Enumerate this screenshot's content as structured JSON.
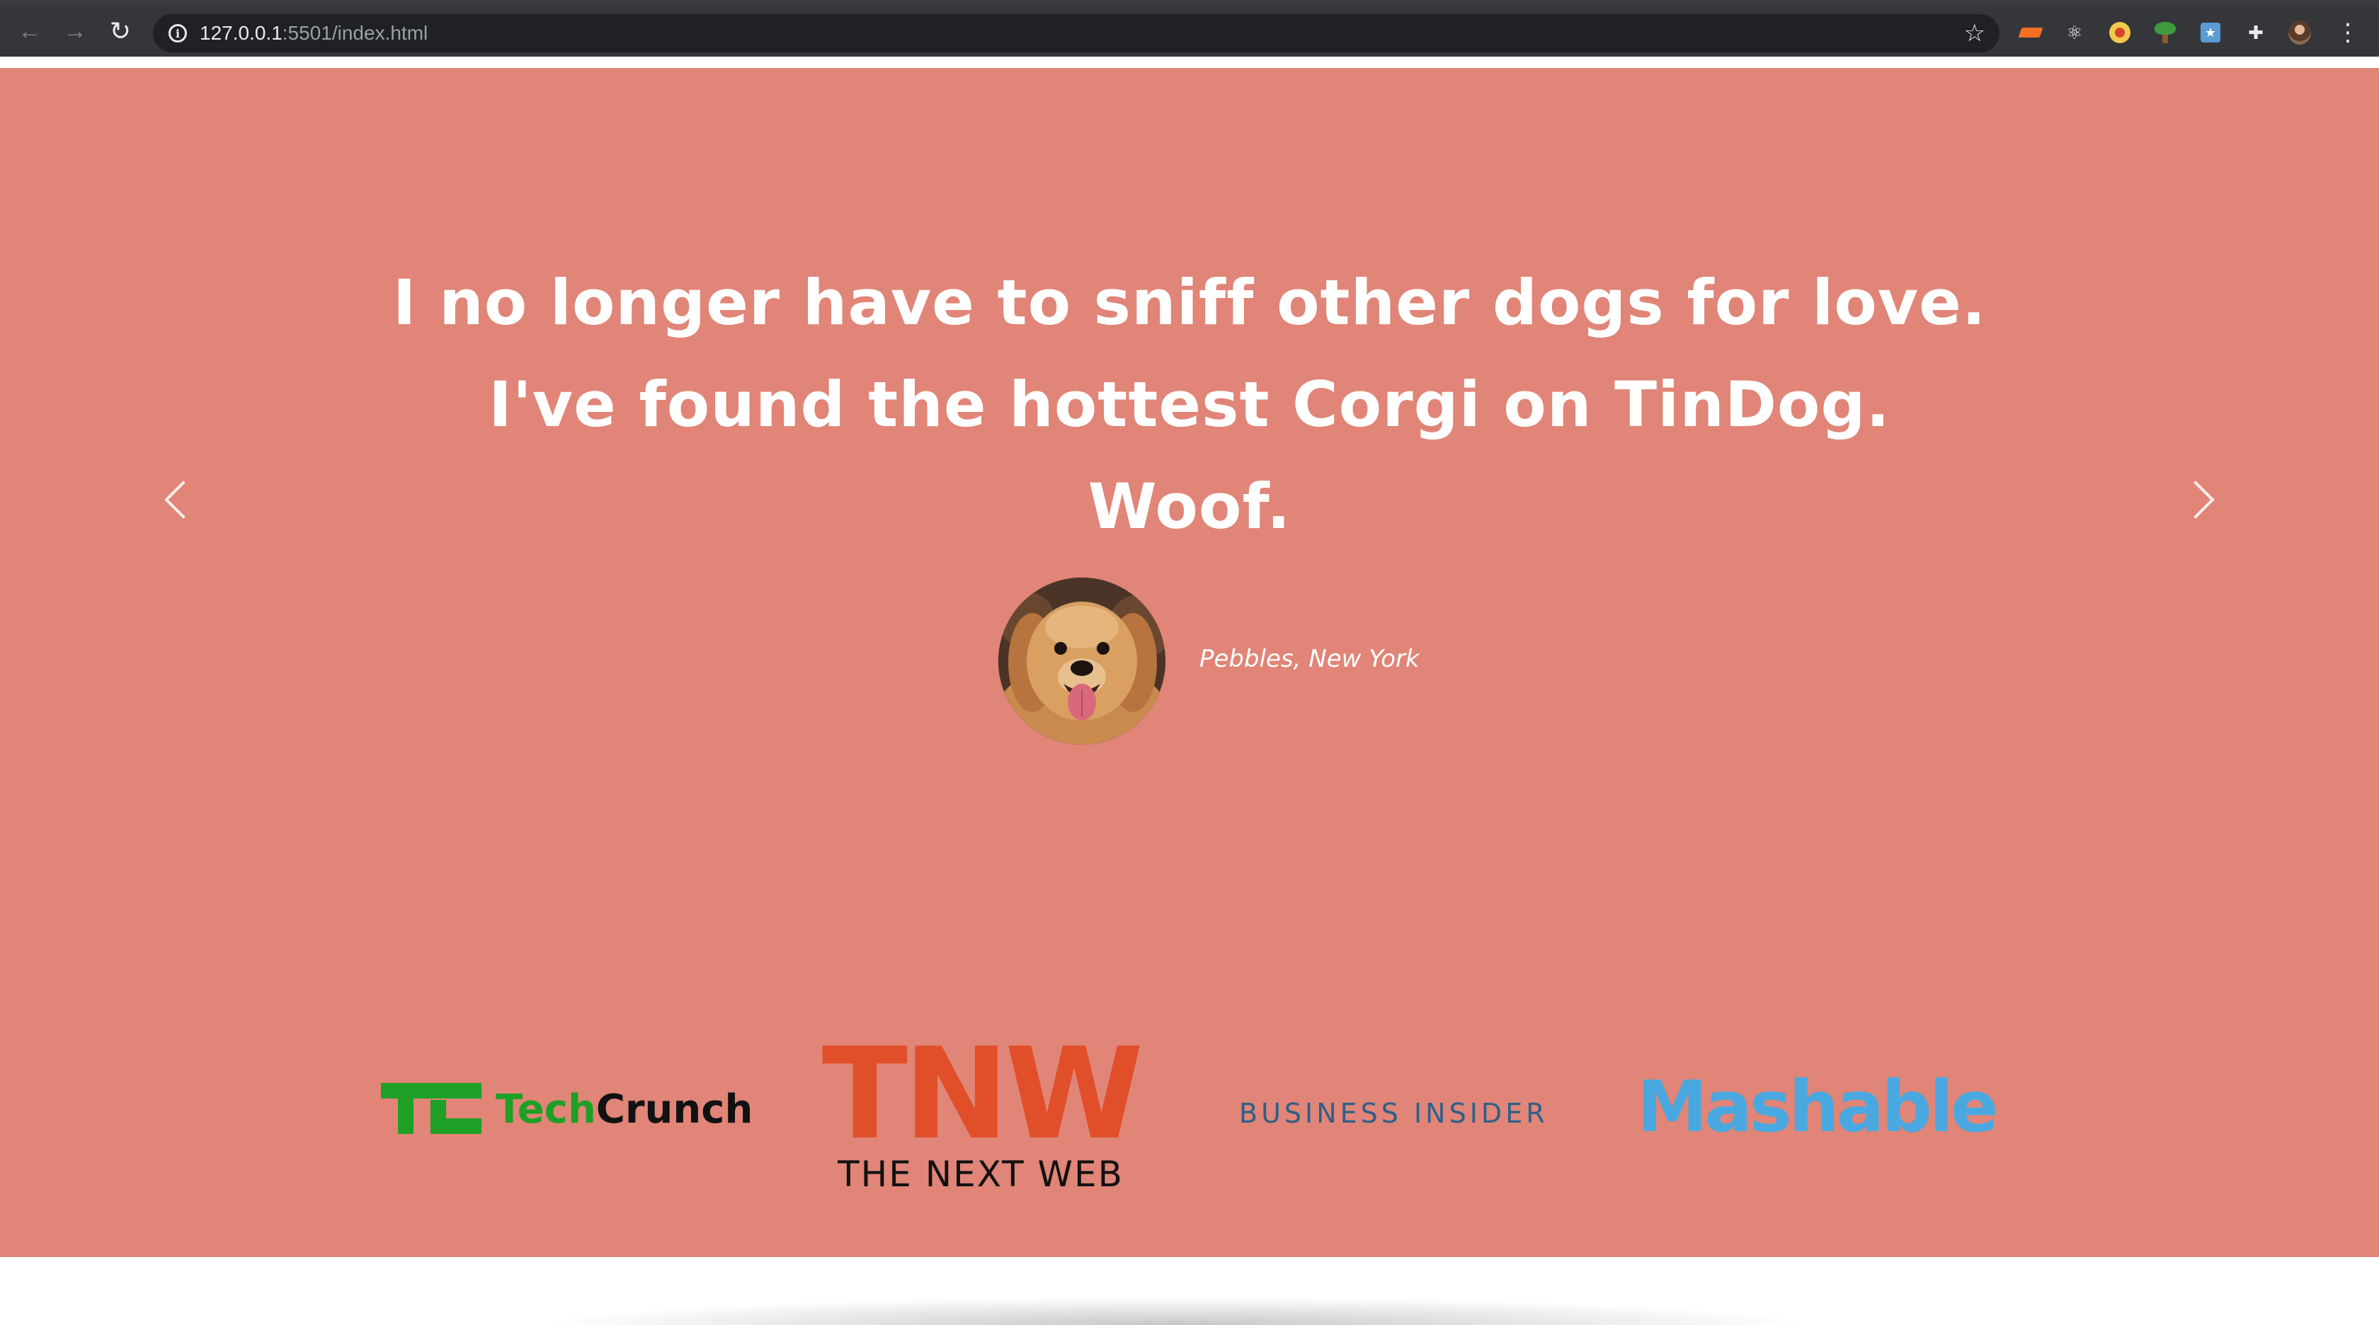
{
  "browser": {
    "url_host": "127.0.0.1",
    "url_rest": ":5501/index.html",
    "back_icon": "←",
    "forward_icon": "→",
    "reload_icon": "↻",
    "info_icon": "i",
    "bookmark_icon": "☆",
    "extensions": [
      "matter-extension-icon",
      "react-devtools-icon",
      "chrome-extension-icon",
      "tree-extension-icon",
      "image-extension-icon",
      "puzzle-extensions-icon",
      "profile-avatar-icon",
      "kebab-menu-icon"
    ],
    "react_glyph": "⚛",
    "puzzle_glyph": "✚",
    "menu_glyph": "⋮",
    "image_glyph": "★"
  },
  "testimonial": {
    "quote_lines": [
      "I no longer have to sniff other dogs for love.",
      "I've found the hottest Corgi on TinDog.",
      "Woof."
    ],
    "author": "Pebbles, New York",
    "background_color": "#e08577"
  },
  "press": {
    "techcrunch_a": "Tech",
    "techcrunch_b": "Crunch",
    "tnw_big": "TNW",
    "tnw_small": "THE NEXT WEB",
    "business_insider": "BUSINESS INSIDER",
    "mashable": "Mashable"
  }
}
